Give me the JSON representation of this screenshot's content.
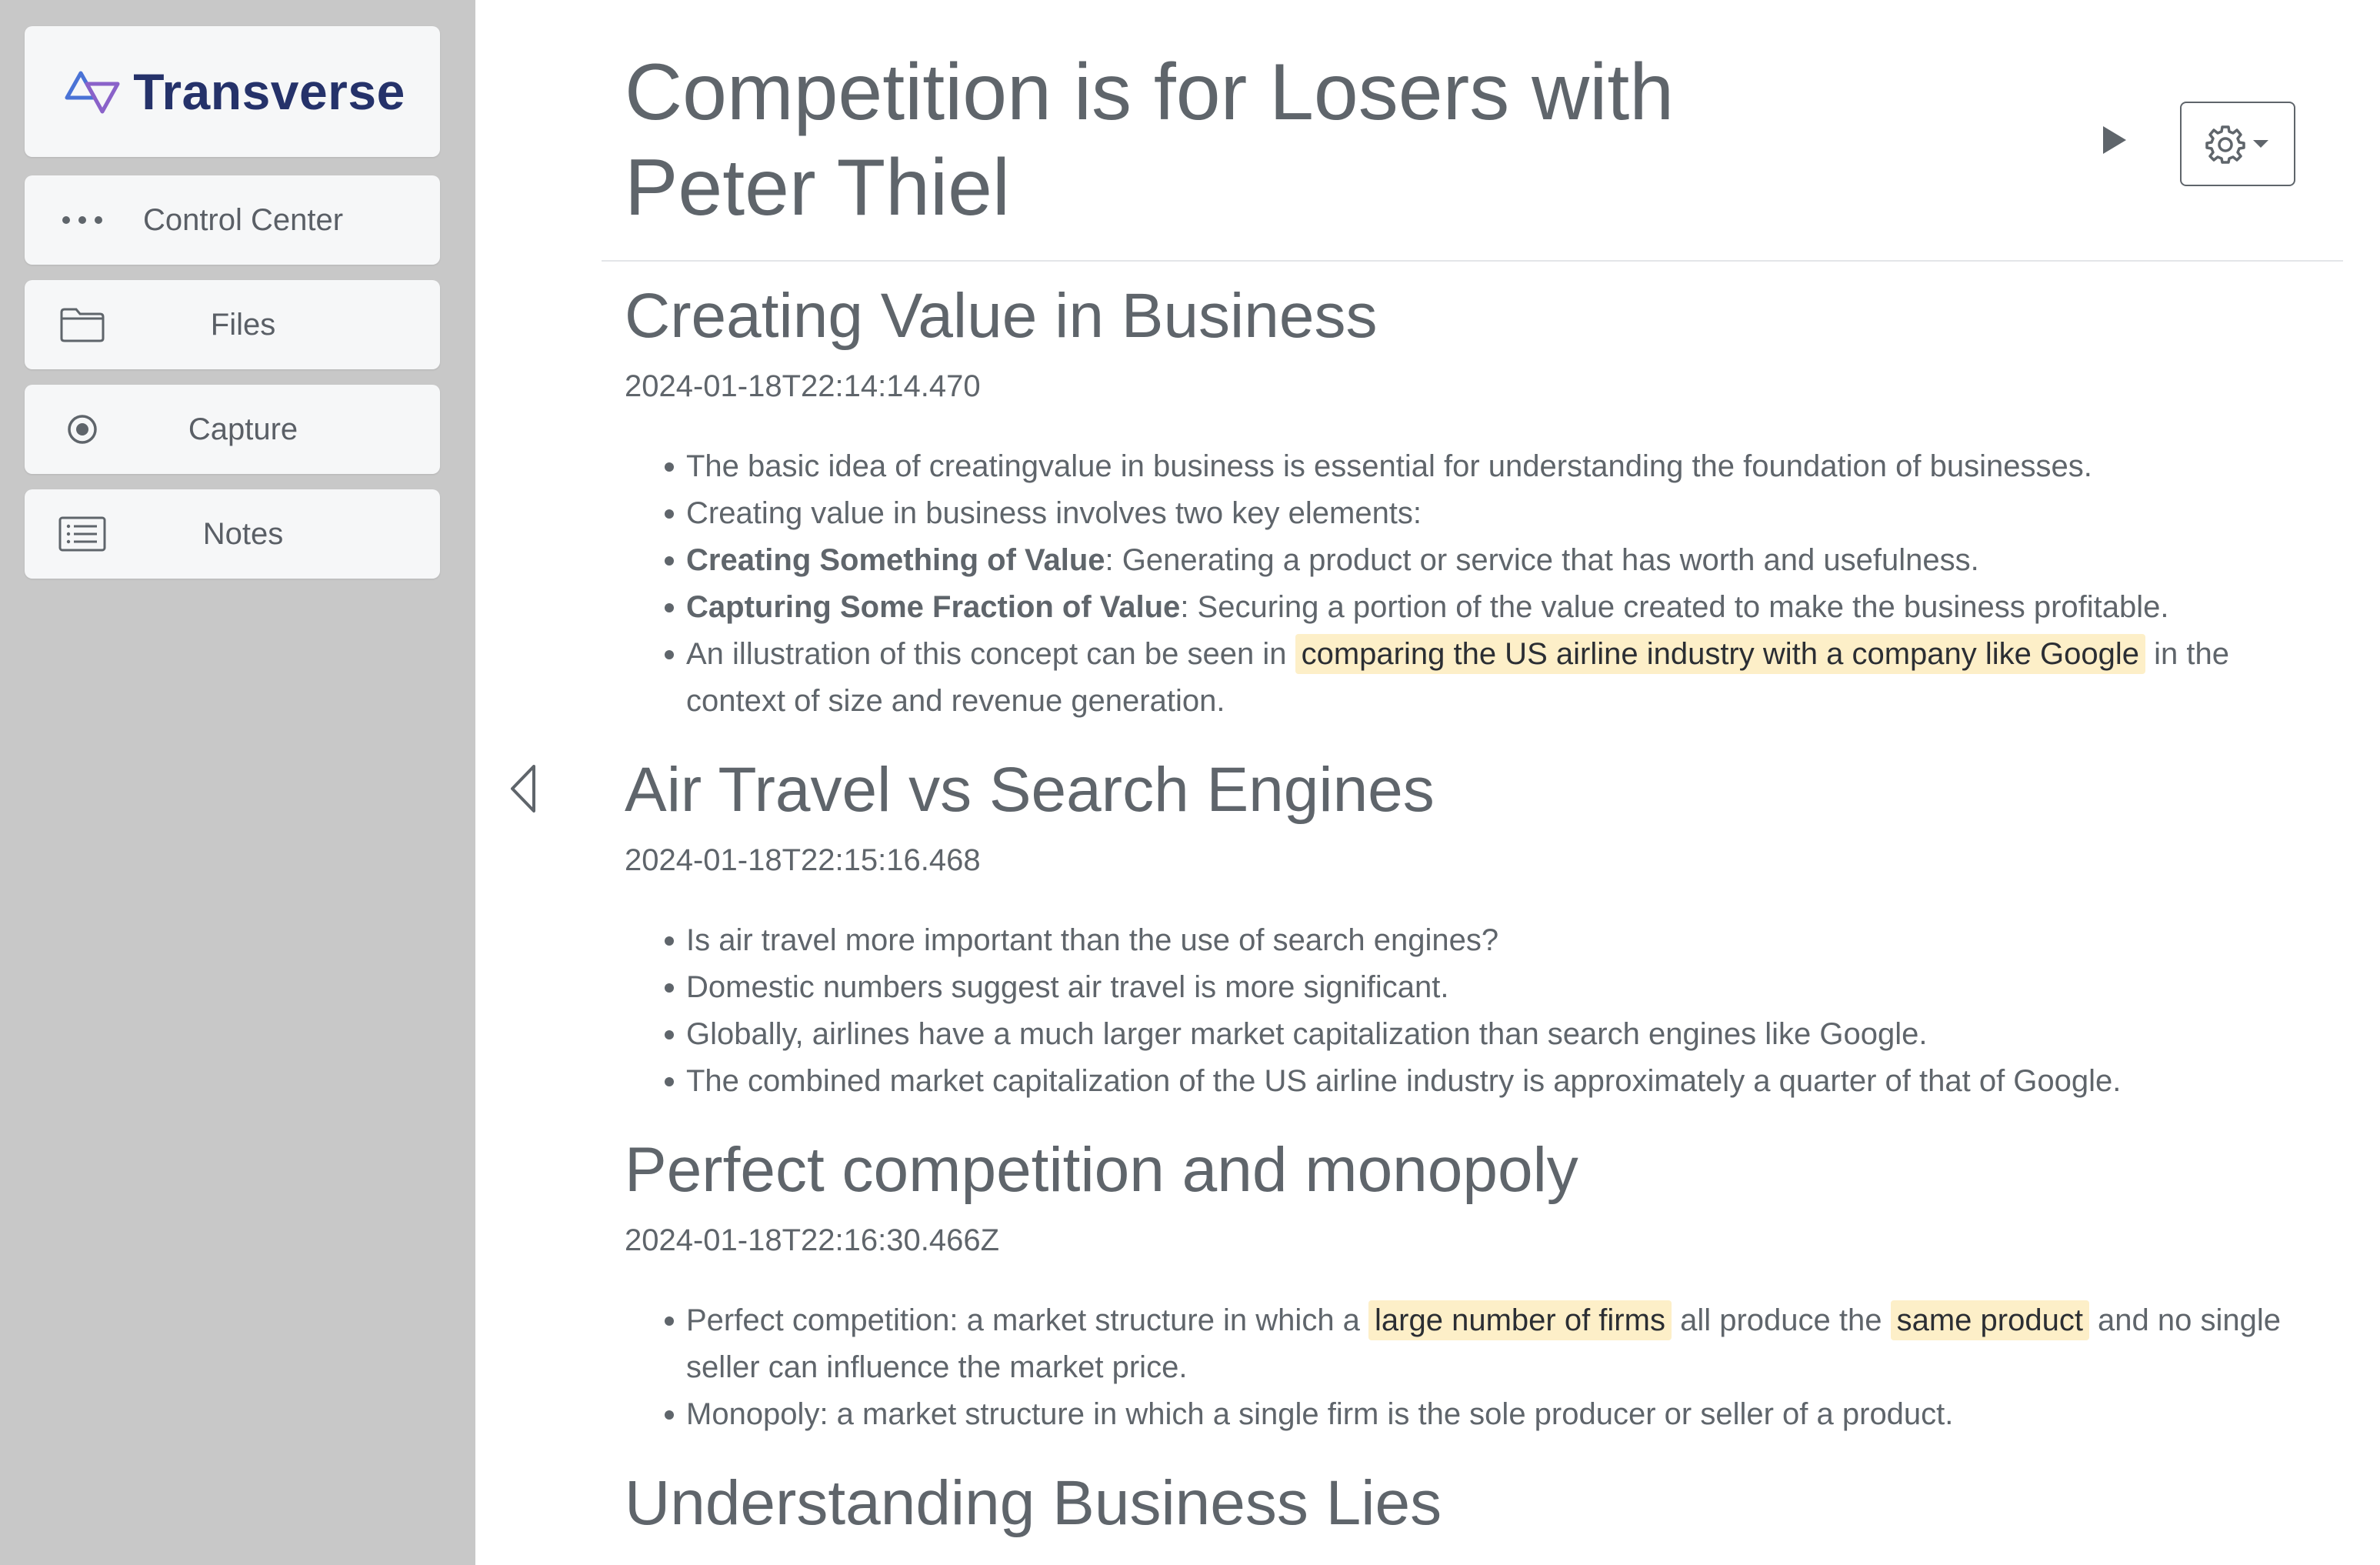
{
  "sidebar": {
    "logo_text": "Transverse",
    "items": [
      {
        "label": "Control Center",
        "icon": "ellipsis-icon"
      },
      {
        "label": "Files",
        "icon": "folder-icon"
      },
      {
        "label": "Capture",
        "icon": "record-icon"
      },
      {
        "label": "Notes",
        "icon": "notes-list-icon"
      }
    ]
  },
  "header": {
    "title": "Competition is for Losers with Peter Thiel"
  },
  "sections": [
    {
      "heading": "Creating Value in Business",
      "timestamp": "2024-01-18T22:14:14.470",
      "bullets": [
        {
          "text": "The basic idea of creatingvalue in business is essential for understanding the foundation of businesses."
        },
        {
          "text": "Creating value in business involves two key elements:"
        },
        {
          "bold": "Creating Something of Value",
          "text": ": Generating a product or service that has worth and usefulness."
        },
        {
          "bold": "Capturing Some Fraction of Value",
          "text": ": Securing a portion of the value created to make the business profitable."
        },
        {
          "pre": "An illustration of this concept can be seen in ",
          "highlight": "comparing the US airline industry with a company like Google",
          "post": " in the context of size and revenue generation."
        }
      ]
    },
    {
      "heading": "Air Travel vs Search Engines",
      "timestamp": "2024-01-18T22:15:16.468",
      "bullets": [
        {
          "text": "Is air travel more important than the use of search engines?"
        },
        {
          "text": "Domestic numbers suggest air travel is more significant."
        },
        {
          "text": "Globally, airlines have a much larger market capitalization than search engines like Google."
        },
        {
          "text": "The combined market capitalization of the US airline industry is approximately a quarter of that of Google."
        }
      ]
    },
    {
      "heading": "Perfect competition and monopoly",
      "timestamp": "2024-01-18T22:16:30.466Z",
      "bullets": [
        {
          "pre": "Perfect competition: a market structure in which a ",
          "highlight": "large number of firms",
          "mid": " all produce the ",
          "highlight2": "same product",
          "post": " and no single seller can influence the market price."
        },
        {
          "text": "Monopoly: a market structure in which a single firm is the sole producer or seller of a product."
        }
      ]
    },
    {
      "heading": "Understanding Business Lies"
    }
  ],
  "colors": {
    "sidebar_bg": "#c8c8c8",
    "card_bg": "#f6f7f8",
    "text": "#5f656b",
    "highlight": "#fdefc8",
    "brand": "#25326a"
  }
}
